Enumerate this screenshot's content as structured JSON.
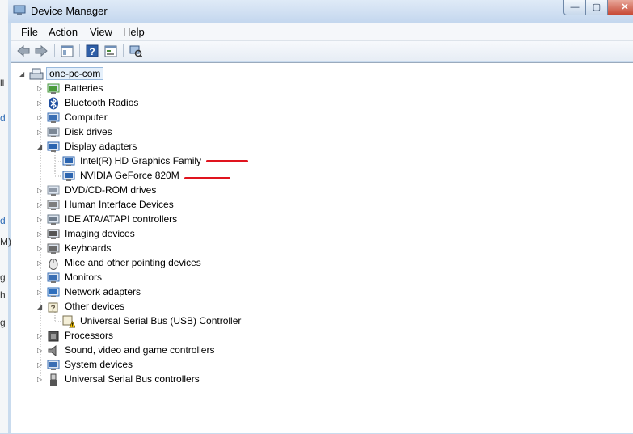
{
  "window": {
    "title": "Device Manager",
    "buttons": {
      "minimize": "—",
      "maximize": "▢",
      "close": "✕"
    }
  },
  "background_fragments": [
    "ll",
    "d",
    "d",
    "M)",
    "g",
    "h",
    "g"
  ],
  "menu": [
    "File",
    "Action",
    "View",
    "Help"
  ],
  "toolbar": {
    "icons": [
      "back-arrow-icon",
      "forward-arrow-icon",
      "show-hide-console-tree-icon",
      "help-icon",
      "properties-icon",
      "scan-hardware-icon"
    ]
  },
  "tree": {
    "root": "one-pc-com",
    "items": [
      {
        "label": "Batteries",
        "icon": "battery-icon",
        "expanded": false
      },
      {
        "label": "Bluetooth Radios",
        "icon": "bluetooth-icon",
        "expanded": false
      },
      {
        "label": "Computer",
        "icon": "computer-icon",
        "expanded": false
      },
      {
        "label": "Disk drives",
        "icon": "disk-drive-icon",
        "expanded": false
      },
      {
        "label": "Display adapters",
        "icon": "display-adapter-icon",
        "expanded": true,
        "children": [
          "Intel(R) HD Graphics Family",
          "NVIDIA GeForce 820M"
        ]
      },
      {
        "label": "DVD/CD-ROM drives",
        "icon": "dvd-drive-icon",
        "expanded": false
      },
      {
        "label": "Human Interface Devices",
        "icon": "hid-icon",
        "expanded": false
      },
      {
        "label": "IDE ATA/ATAPI controllers",
        "icon": "ide-controller-icon",
        "expanded": false
      },
      {
        "label": "Imaging devices",
        "icon": "camera-icon",
        "expanded": false
      },
      {
        "label": "Keyboards",
        "icon": "keyboard-icon",
        "expanded": false
      },
      {
        "label": "Mice and other pointing devices",
        "icon": "mouse-icon",
        "expanded": false
      },
      {
        "label": "Monitors",
        "icon": "monitor-icon",
        "expanded": false
      },
      {
        "label": "Network adapters",
        "icon": "network-icon",
        "expanded": false
      },
      {
        "label": "Other devices",
        "icon": "unknown-device-icon",
        "expanded": true,
        "children": [
          "Universal Serial Bus (USB) Controller"
        ]
      },
      {
        "label": "Processors",
        "icon": "processor-icon",
        "expanded": false
      },
      {
        "label": "Sound, video and game controllers",
        "icon": "speaker-icon",
        "expanded": false
      },
      {
        "label": "System devices",
        "icon": "system-device-icon",
        "expanded": false
      },
      {
        "label": "Universal Serial Bus controllers",
        "icon": "usb-icon",
        "expanded": false
      }
    ]
  },
  "colors": {
    "annotation_red": "#e0141e",
    "title_bar": "#c4d7ee"
  }
}
